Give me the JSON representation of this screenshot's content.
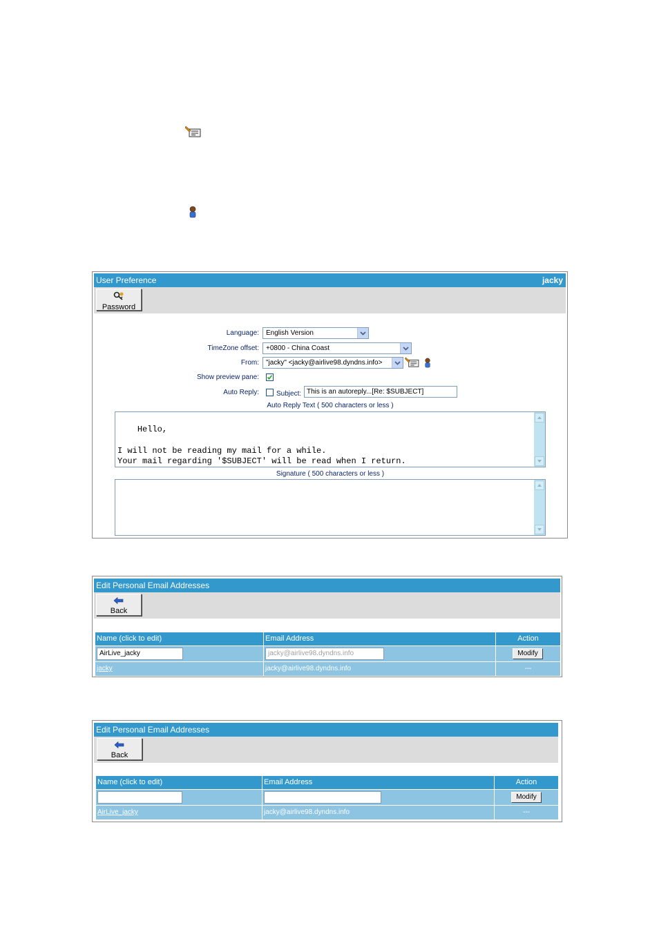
{
  "floating_icons": [
    {
      "icon": "edit-contact-icon"
    },
    {
      "icon": "user-icon"
    }
  ],
  "pref": {
    "title": "User Preference",
    "user": "jacky",
    "password_button": "Password",
    "language_label": "Language:",
    "language_value": "English Version",
    "timezone_label": "TimeZone offset:",
    "timezone_value": "+0800 - China Coast",
    "from_label": "From:",
    "from_value": "\"jacky\" <jacky@airlive98.dyndns.info>",
    "preview_label": "Show preview pane:",
    "preview_checked": true,
    "autoreply_label": "Auto Reply:",
    "autoreply_checked": false,
    "subject_label": "Subject:",
    "subject_value": "This is an autoreply...[Re: $SUBJECT]",
    "autoreply_text_label": "Auto Reply Text ( 500 characters or less )",
    "autoreply_text": "Hello,\n\nI will not be reading my mail for a while.\nYour mail regarding '$SUBJECT' will be read when I return.",
    "signature_label": "Signature ( 500 characters or less )",
    "signature_text": ""
  },
  "edit1": {
    "title": "Edit Personal Email Addresses",
    "back": "Back",
    "col_name": "Name (click to edit)",
    "col_email": "Email Address",
    "col_action": "Action",
    "input_name": "AirLive_jacky",
    "input_email_placeholder": "jacky@airlive98.dyndns.info",
    "modify": "Modify",
    "row_name": "jacky",
    "row_email": "jacky@airlive98.dyndns.info",
    "row_action": "---"
  },
  "edit2": {
    "title": "Edit Personal Email Addresses",
    "back": "Back",
    "col_name": "Name (click to edit)",
    "col_email": "Email Address",
    "col_action": "Action",
    "input_name": "",
    "input_email": "",
    "modify": "Modify",
    "row_name": "AirLive_jacky",
    "row_email": "jacky@airlive98.dyndns.info",
    "row_action": "---"
  }
}
